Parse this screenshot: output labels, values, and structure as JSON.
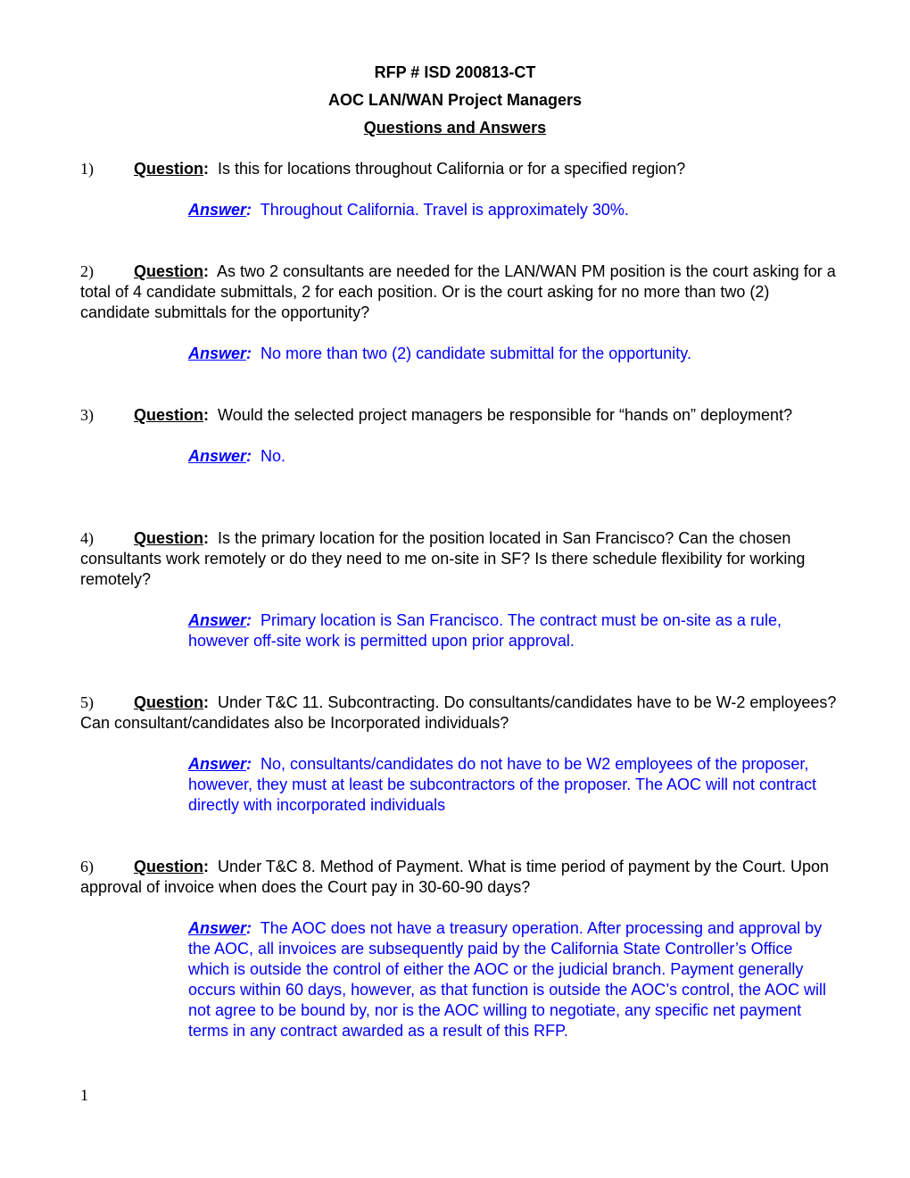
{
  "header": {
    "rfp_number": "RFP # ISD 200813-CT",
    "project": "AOC LAN/WAN Project Managers",
    "section": "Questions and Answers"
  },
  "labels": {
    "question": "Question",
    "answer": "Answer",
    "colon": ":"
  },
  "qa": [
    {
      "number": "1)",
      "question": "Is this for locations throughout California or for a specified region?",
      "answer": "Throughout California.  Travel is approximately 30%."
    },
    {
      "number": "2)",
      "question": "As two 2 consultants are needed for the LAN/WAN PM position is the court asking for a total of 4 candidate submittals, 2 for each position. Or is the court asking for no more than two (2) candidate submittals for the opportunity?",
      "answer": "No more than two (2) candidate submittal for the opportunity."
    },
    {
      "number": "3)",
      "question": "Would the selected project managers be responsible for “hands on” deployment?",
      "answer": "No."
    },
    {
      "number": "4)",
      "question": "Is the primary location for the position located in San Francisco? Can the chosen consultants work remotely or do they need to me on-site in SF? Is there schedule flexibility for working remotely?",
      "answer": "Primary location is San Francisco.  The contract must be on-site as a rule, however off-site work is permitted upon prior approval."
    },
    {
      "number": "5)",
      "question": "Under T&C 11. Subcontracting.  Do consultants/candidates have to be W-2 employees? Can consultant/candidates also be Incorporated individuals?",
      "answer": "No, consultants/candidates do not have to be W2 employees of the proposer, however, they must at least be subcontractors of the proposer.  The AOC will not contract directly with incorporated individuals"
    },
    {
      "number": "6)",
      "question": "Under T&C 8. Method of Payment. What is time period of payment by the Court. Upon approval of invoice when does the Court pay in 30-60-90 days?",
      "answer": "The AOC does not have a treasury operation.  After processing and approval by the AOC, all invoices are subsequently paid by the California State Controller’s Office which is outside the control of either the AOC or the judicial branch.  Payment generally occurs within 60 days, however, as that function is outside the AOC’s control, the AOC will not agree to be bound by, nor is the AOC willing to negotiate, any specific net payment terms in any contract awarded as a result of this RFP."
    }
  ],
  "footer": {
    "page_number": "1"
  },
  "colors": {
    "answer_text": "#0000ff",
    "body_text": "#000000"
  }
}
